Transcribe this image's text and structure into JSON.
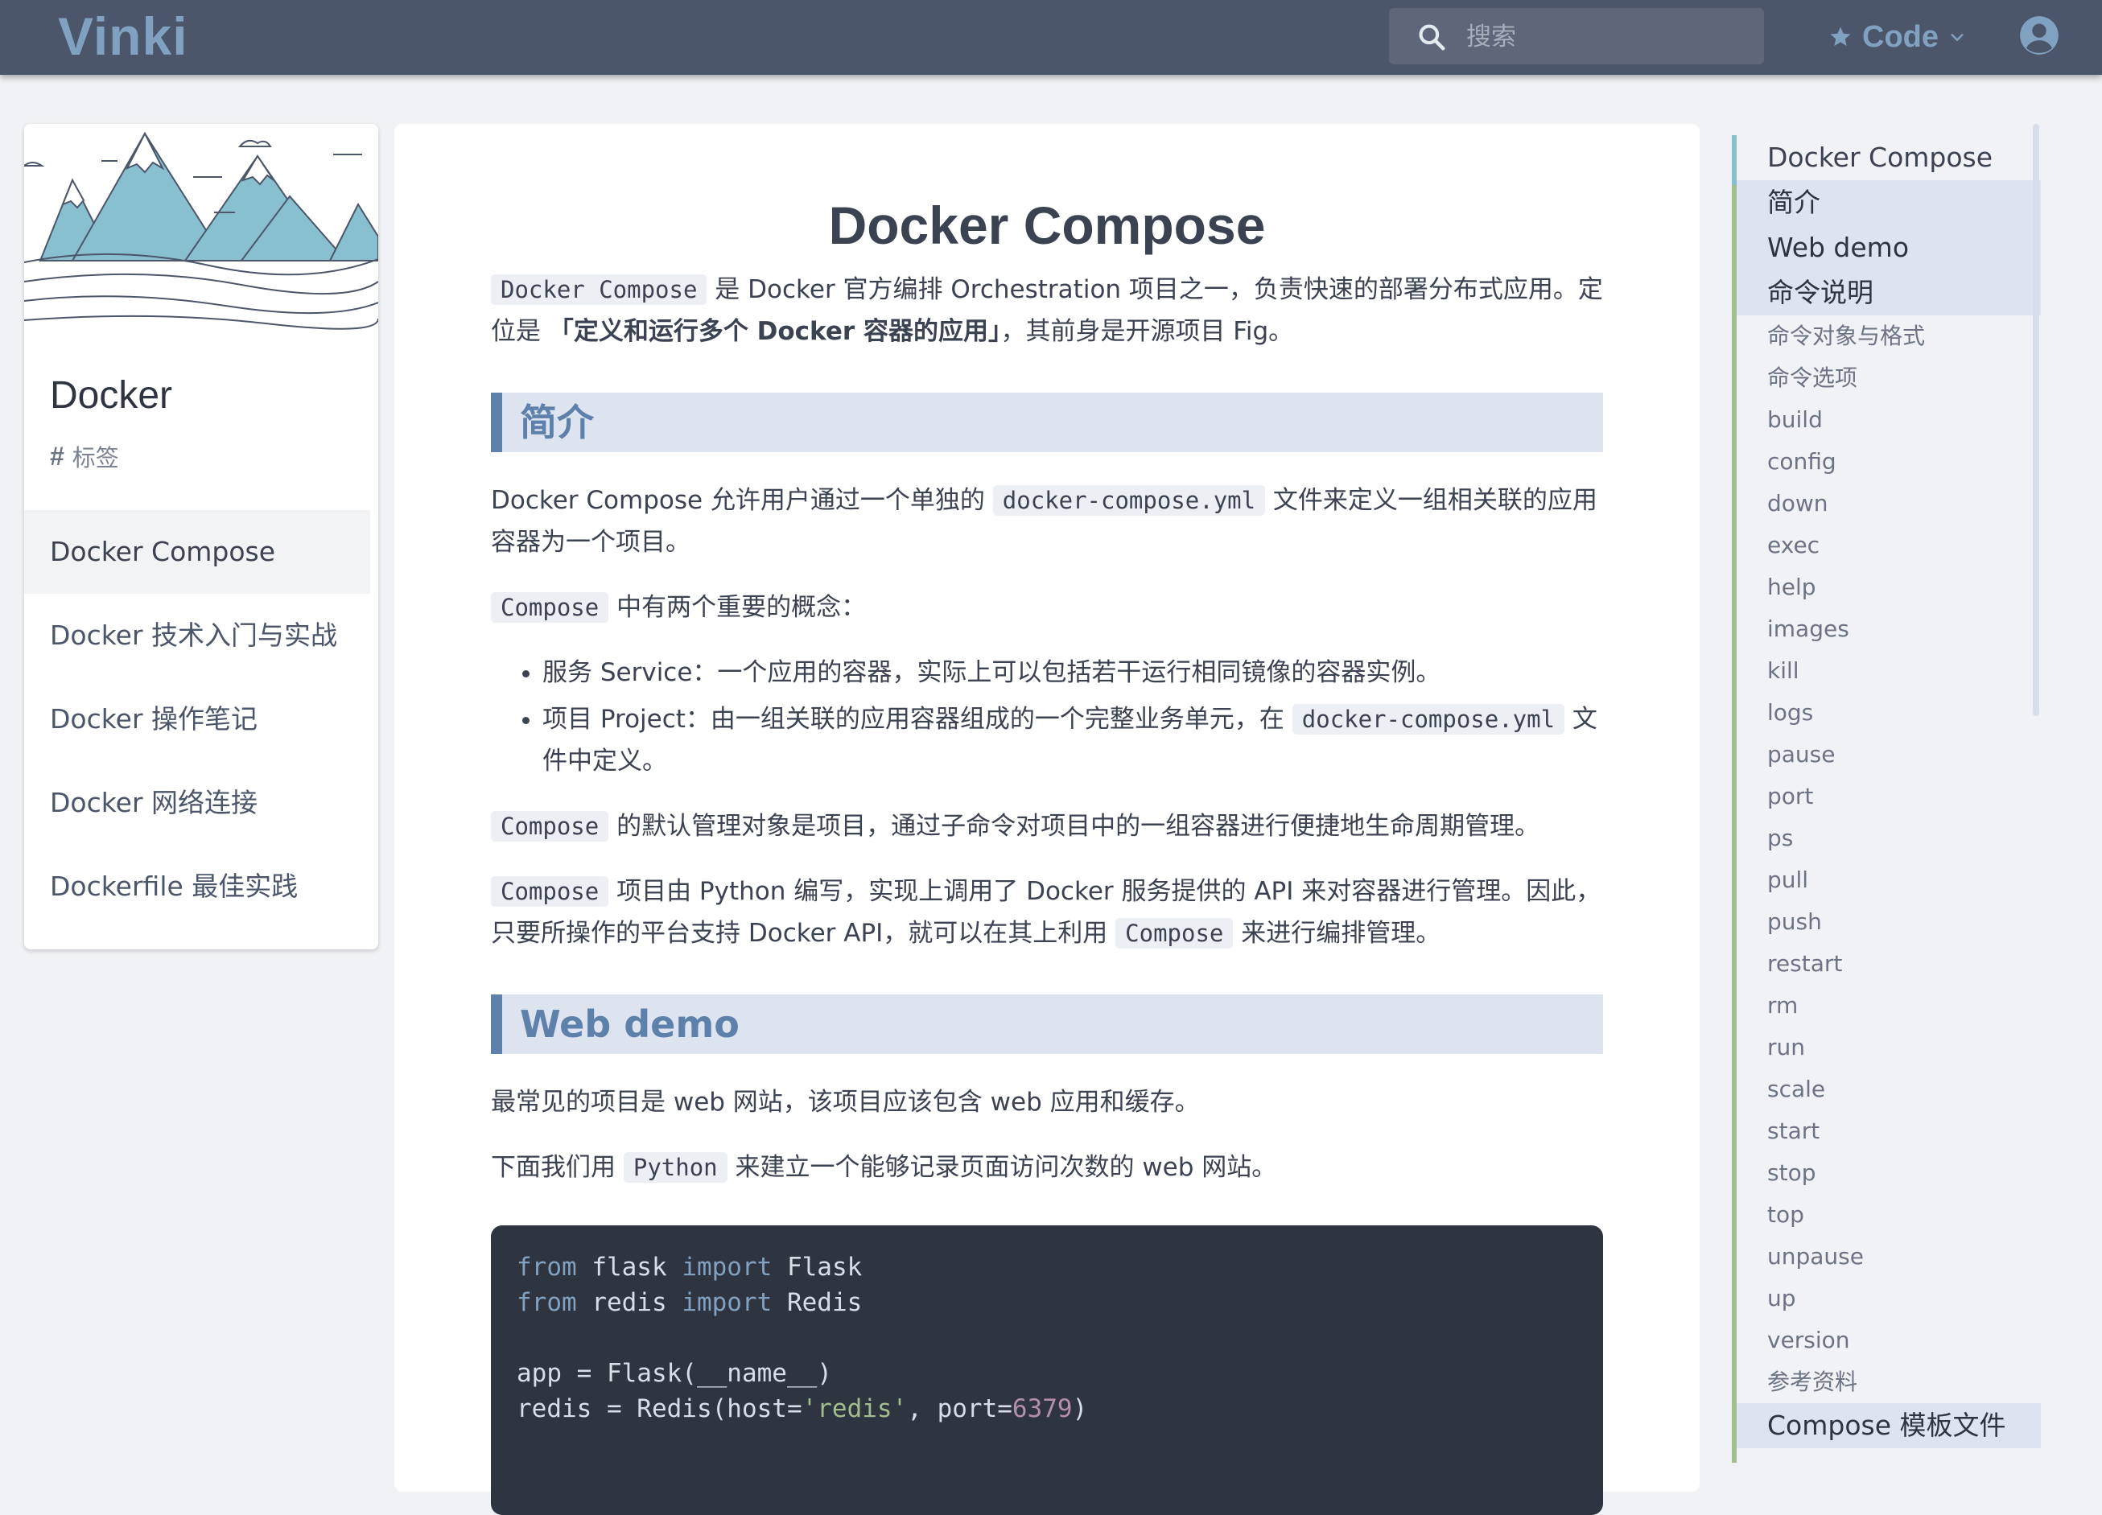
{
  "header": {
    "logo": "Vinki",
    "search_placeholder": "搜索",
    "code_label": "Code"
  },
  "sidebar": {
    "title": "Docker",
    "tags_label": "标签",
    "items": [
      {
        "label": "Docker Compose"
      },
      {
        "label": "Docker 技术入门与实战"
      },
      {
        "label": "Docker 操作笔记"
      },
      {
        "label": "Docker 网络连接"
      },
      {
        "label": "Dockerfile 最佳实践"
      }
    ]
  },
  "article": {
    "title": "Docker Compose",
    "intro": {
      "code": "Docker Compose",
      "text1": " 是 Docker 官方编排 Orchestration 项目之一，负责快速的部署分布式应用。定位是 ",
      "strong": "「定义和运行多个 Docker 容器的应用」",
      "text2": "，其前身是开源项目 Fig。"
    },
    "sec1": {
      "heading": "简介",
      "p1a": "Docker Compose 允许用户通过一个单独的 ",
      "p1code": "docker-compose.yml",
      "p1b": " 文件来定义一组相关联的应用容器为一个项目。",
      "p2code": "Compose",
      "p2": " 中有两个重要的概念：",
      "bullet1": "服务 Service：一个应用的容器，实际上可以包括若干运行相同镜像的容器实例。",
      "bullet2a": "项目 Project：由一组关联的应用容器组成的一个完整业务单元，在 ",
      "bullet2code": "docker-compose.yml",
      "bullet2b": " 文件中定义。",
      "p3code": "Compose",
      "p3": " 的默认管理对象是项目，通过子命令对项目中的一组容器进行便捷地生命周期管理。",
      "p4code": "Compose",
      "p4a": " 项目由 Python 编写，实现上调用了 Docker 服务提供的 API 来对容器进行管理。因此，只要所操作的平台支持 Docker API，就可以在其上利用 ",
      "p4code2": "Compose",
      "p4b": " 来进行编排管理。"
    },
    "sec2": {
      "heading": "Web demo",
      "p1": "最常见的项目是 web 网站，该项目应该包含 web 应用和缓存。",
      "p2a": "下面我们用 ",
      "p2code": "Python",
      "p2b": " 来建立一个能够记录页面访问次数的 web 网站。"
    },
    "code": {
      "l1_kw1": "from",
      "l1_mod": " flask ",
      "l1_kw2": "import",
      "l1_name": " Flask",
      "l2_kw1": "from",
      "l2_mod": " redis ",
      "l2_kw2": "import",
      "l2_name": " Redis",
      "l4": "app = Flask(__name__)",
      "l5a": "redis = Redis(host=",
      "l5str": "'redis'",
      "l5b": ", port=",
      "l5num": "6379",
      "l5c": ")"
    }
  },
  "toc": {
    "items": [
      {
        "label": "Docker Compose",
        "level": 1,
        "highlight": false
      },
      {
        "label": "简介",
        "level": 1,
        "highlight": true
      },
      {
        "label": "Web demo",
        "level": 1,
        "highlight": true
      },
      {
        "label": "命令说明",
        "level": 1,
        "highlight": true
      },
      {
        "label": "命令对象与格式",
        "level": 2
      },
      {
        "label": "命令选项",
        "level": 2
      },
      {
        "label": "build",
        "level": 2
      },
      {
        "label": "config",
        "level": 2
      },
      {
        "label": "down",
        "level": 2
      },
      {
        "label": "exec",
        "level": 2
      },
      {
        "label": "help",
        "level": 2
      },
      {
        "label": "images",
        "level": 2
      },
      {
        "label": "kill",
        "level": 2
      },
      {
        "label": "logs",
        "level": 2
      },
      {
        "label": "pause",
        "level": 2
      },
      {
        "label": "port",
        "level": 2
      },
      {
        "label": "ps",
        "level": 2
      },
      {
        "label": "pull",
        "level": 2
      },
      {
        "label": "push",
        "level": 2
      },
      {
        "label": "restart",
        "level": 2
      },
      {
        "label": "rm",
        "level": 2
      },
      {
        "label": "run",
        "level": 2
      },
      {
        "label": "scale",
        "level": 2
      },
      {
        "label": "start",
        "level": 2
      },
      {
        "label": "stop",
        "level": 2
      },
      {
        "label": "top",
        "level": 2
      },
      {
        "label": "unpause",
        "level": 2
      },
      {
        "label": "up",
        "level": 2
      },
      {
        "label": "version",
        "level": 2
      },
      {
        "label": "参考资料",
        "level": 2
      },
      {
        "label": "Compose 模板文件",
        "level": 1,
        "highlight": true
      }
    ]
  },
  "colors": {
    "topbar": "#4c566a",
    "accent": "#81a1c1",
    "heading_accent": "#5e81ac",
    "toc_rail": "#a3be8c"
  }
}
